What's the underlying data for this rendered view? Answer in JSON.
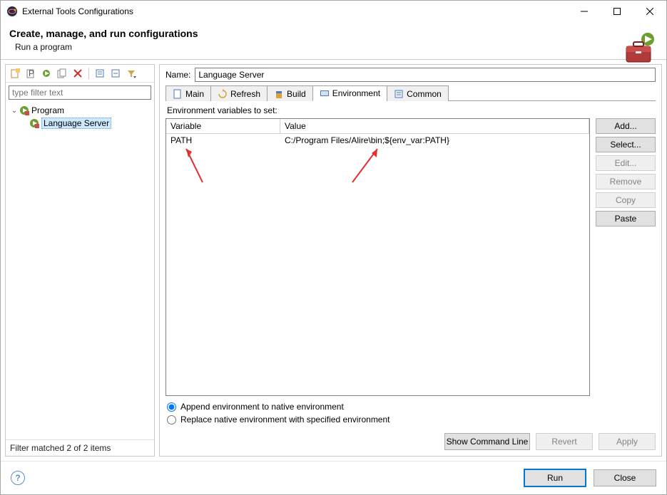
{
  "window": {
    "title": "External Tools Configurations"
  },
  "header": {
    "title": "Create, manage, and run configurations",
    "subtitle": "Run a program"
  },
  "leftPanel": {
    "filter_placeholder": "type filter text",
    "status": "Filter matched 2 of 2 items",
    "tree": {
      "root": "Program",
      "child": "Language Server"
    }
  },
  "rightPanel": {
    "name_label": "Name:",
    "name_value": "Language Server",
    "tabs": {
      "main": "Main",
      "refresh": "Refresh",
      "build": "Build",
      "environment": "Environment",
      "common": "Common"
    },
    "envLabel": "Environment variables to set:",
    "table": {
      "col_variable": "Variable",
      "col_value": "Value",
      "row": {
        "variable": "PATH",
        "value": "C:/Program Files/Alire\\bin;${env_var:PATH}"
      }
    },
    "buttons": {
      "add": "Add...",
      "select": "Select...",
      "edit": "Edit...",
      "remove": "Remove",
      "copy": "Copy",
      "paste": "Paste"
    },
    "radios": {
      "append": "Append environment to native environment",
      "replace": "Replace native environment with specified environment"
    },
    "bottom": {
      "showcmd": "Show Command Line",
      "revert": "Revert",
      "apply": "Apply"
    }
  },
  "footer": {
    "run": "Run",
    "close": "Close"
  }
}
